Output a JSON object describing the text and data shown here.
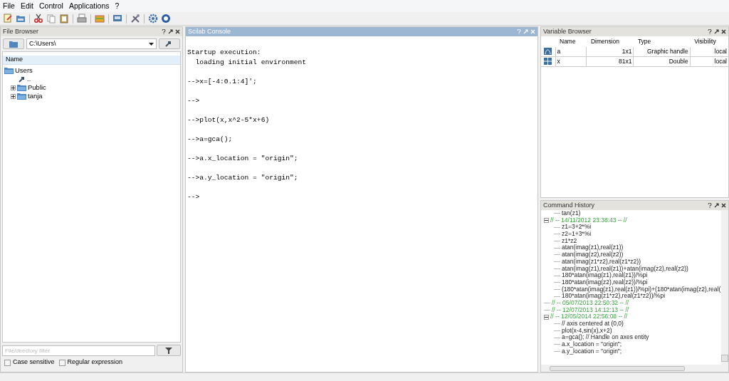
{
  "menu": [
    "File",
    "Edit",
    "Control",
    "Applications",
    "?"
  ],
  "file_browser": {
    "title": "File Browser",
    "path": "C:\\Users\\",
    "column": "Name",
    "tree": [
      {
        "kind": "folder",
        "label": "Users",
        "expanded": true,
        "children": [
          {
            "kind": "up",
            "label": ".."
          },
          {
            "kind": "folder",
            "label": "Public",
            "expanded": false
          },
          {
            "kind": "folder",
            "label": "tanja",
            "expanded": false
          }
        ]
      }
    ],
    "filter_placeholder": "File/directory filter",
    "options": [
      {
        "label": "Case sensitive",
        "checked": false
      },
      {
        "label": "Regular expression",
        "checked": false
      }
    ]
  },
  "console": {
    "title": "Scilab Console",
    "blocks": [
      [
        "Startup execution:",
        "  loading initial environment"
      ],
      [
        "-->x=[-4:0.1:4]';"
      ],
      [
        "-->"
      ],
      [
        "-->plot(x,x^2-5*x+6)"
      ],
      [
        "-->a=gca();"
      ],
      [
        "-->a.x_location = \"origin\";"
      ],
      [
        "-->a.y_location = \"origin\";"
      ],
      [
        "-->"
      ]
    ]
  },
  "variable_browser": {
    "title": "Variable Browser",
    "columns": [
      "Name",
      "Dimension",
      "Type",
      "Visibility"
    ],
    "rows": [
      {
        "kind": "graphic",
        "name": "a",
        "dimension": "1x1",
        "type": "Graphic handle",
        "visibility": "local"
      },
      {
        "kind": "matrix",
        "name": "x",
        "dimension": "81x1",
        "type": "Double",
        "visibility": "local"
      }
    ]
  },
  "command_history": {
    "title": "Command History",
    "entries": [
      {
        "kind": "command",
        "text": "tan(z1)"
      },
      {
        "kind": "session",
        "text": "// -- 14/11/2012 23:38:43 -- //",
        "expanded": true,
        "children": [
          {
            "kind": "command",
            "text": "z1=3+2*%i"
          },
          {
            "kind": "command",
            "text": "z2=1+3*%i"
          },
          {
            "kind": "command",
            "text": "z1*z2"
          },
          {
            "kind": "command",
            "text": "atan(imag(z1),real(z1))"
          },
          {
            "kind": "command",
            "text": "atan(imag(z2),real(z2))"
          },
          {
            "kind": "command",
            "text": "atan(imag(z1*z2),real(z1*z2))"
          },
          {
            "kind": "command",
            "text": "atan(imag(z1),real(z1))+atan(imag(z2),real(z2))"
          },
          {
            "kind": "command",
            "text": "180*atan(imag(z1),real(z1))/%pi"
          },
          {
            "kind": "command",
            "text": "180*atan(imag(z2),real(z2))/%pi"
          },
          {
            "kind": "command",
            "text": "(180*atan(imag(z1),real(z1))/%pi)+(180*atan(imag(z2),real("
          },
          {
            "kind": "command",
            "text": "180*atan(imag(z1*z2),real(z1*z2))/%pi"
          }
        ]
      },
      {
        "kind": "session",
        "text": "// -- 05/07/2013 22:50:32 -- //"
      },
      {
        "kind": "session",
        "text": "// -- 12/07/2013 14:12:13 -- //"
      },
      {
        "kind": "session",
        "text": "// -- 12/05/2014 22:56:08 -- //",
        "expanded": true,
        "children": [
          {
            "kind": "command",
            "text": "// axis centered at (0,0)"
          },
          {
            "kind": "command",
            "text": "plot(x-4,sin(x),x+2)"
          },
          {
            "kind": "command",
            "text": "a=gca(); // Handle on axes entity"
          },
          {
            "kind": "command",
            "text": "a.x_location = \"origin\";"
          },
          {
            "kind": "command",
            "text": "a.y_location = \"origin\";"
          }
        ]
      }
    ]
  }
}
